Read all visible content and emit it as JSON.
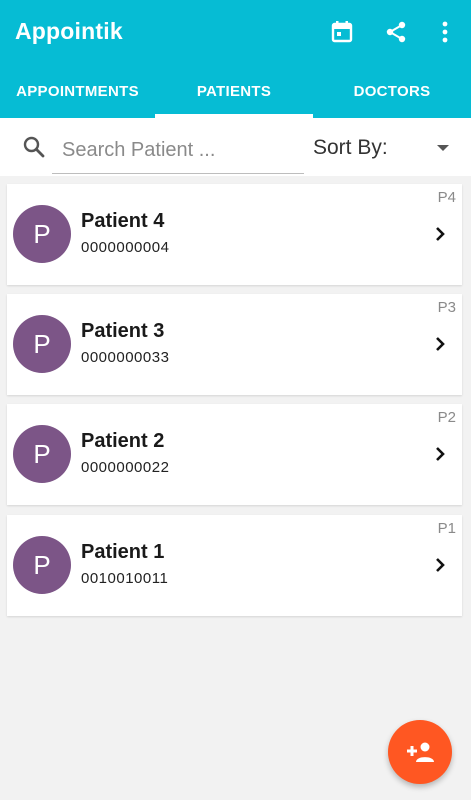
{
  "app": {
    "title": "Appointik"
  },
  "actions": [
    {
      "name": "calendar-icon"
    },
    {
      "name": "share-icon"
    },
    {
      "name": "more-vert-icon"
    }
  ],
  "tabs": [
    {
      "label": "APPOINTMENTS",
      "active": false
    },
    {
      "label": "PATIENTS",
      "active": true
    },
    {
      "label": "DOCTORS",
      "active": false
    }
  ],
  "search": {
    "placeholder": "Search Patient ...",
    "value": ""
  },
  "sort": {
    "label": "Sort By:"
  },
  "patients": [
    {
      "initial": "P",
      "name": "Patient 4",
      "phone": "0000000004",
      "code": "P4"
    },
    {
      "initial": "P",
      "name": "Patient 3",
      "phone": "0000000033",
      "code": "P3"
    },
    {
      "initial": "P",
      "name": "Patient 2",
      "phone": "0000000022",
      "code": "P2"
    },
    {
      "initial": "P",
      "name": "Patient 1",
      "phone": "0010010011",
      "code": "P1"
    }
  ],
  "fab": {
    "icon": "add-person-icon"
  },
  "colors": {
    "app_bar": "#06bcd4",
    "avatar": "#7c5587",
    "fab": "#ff5722",
    "background": "#f2f2f2"
  }
}
